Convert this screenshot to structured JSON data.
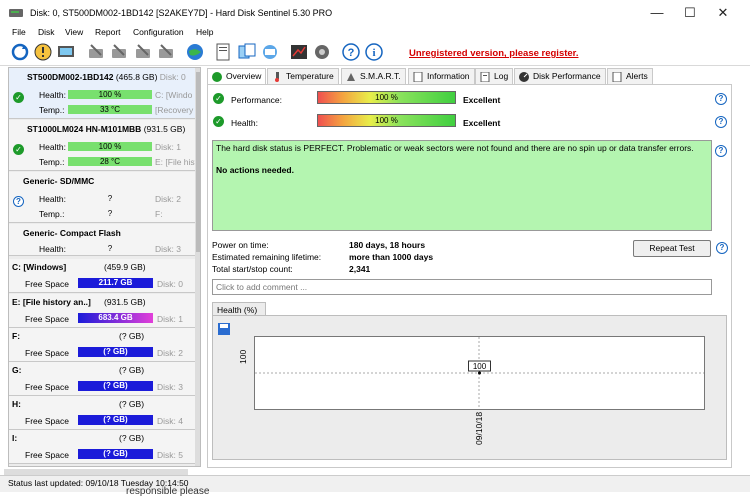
{
  "window": {
    "title": "Disk: 0, ST500DM002-1BD142 [S2AKEY7D]  -  Hard Disk Sentinel 5.30 PRO",
    "minimize": "—",
    "maximize": "☐",
    "close": "✕"
  },
  "menu": [
    "File",
    "Disk",
    "View",
    "Report",
    "Configuration",
    "Help"
  ],
  "toolbar": {
    "unregistered": "Unregistered version, please register."
  },
  "disks": [
    {
      "name": "ST500DM002-1BD142",
      "size": "(465.8 GB)",
      "disk": "Disk: 0",
      "health_label": "Health:",
      "health": "100 %",
      "health_side": "C: [Windo",
      "temp_label": "Temp.:",
      "temp": "33 °C",
      "temp_side": "[Recovery"
    },
    {
      "name": "ST1000LM024 HN-M101MBB",
      "size": "(931.5 GB)",
      "disk": "",
      "health_label": "Health:",
      "health": "100 %",
      "health_side": "Disk: 1",
      "temp_label": "Temp.:",
      "temp": "28 °C",
      "temp_side": "E: [File hist"
    },
    {
      "name": "Generic- SD/MMC",
      "size": "",
      "disk": "",
      "health_label": "Health:",
      "health": "?",
      "health_side": "Disk: 2",
      "temp_label": "Temp.:",
      "temp": "?",
      "temp_side": "F:"
    },
    {
      "name": "Generic- Compact Flash",
      "size": "",
      "disk": "",
      "health_label": "Health:",
      "health": "?",
      "health_side": "Disk: 3"
    }
  ],
  "partitions": [
    {
      "name": "C: [Windows]",
      "size": "(459.9 GB)",
      "fs_label": "Free Space",
      "free": "211.7 GB",
      "disk": "Disk: 0"
    },
    {
      "name": "E: [File history an..]",
      "size": "(931.5 GB)",
      "fs_label": "Free Space",
      "free": "683.4 GB",
      "disk": "Disk: 1"
    },
    {
      "name": "F:",
      "size": "(? GB)",
      "fs_label": "Free Space",
      "free": "(? GB)",
      "disk": "Disk: 2"
    },
    {
      "name": "G:",
      "size": "(? GB)",
      "fs_label": "Free Space",
      "free": "(? GB)",
      "disk": "Disk: 3"
    },
    {
      "name": "H:",
      "size": "(? GB)",
      "fs_label": "Free Space",
      "free": "(? GB)",
      "disk": "Disk: 4"
    },
    {
      "name": "I:",
      "size": "(? GB)",
      "fs_label": "Free Space",
      "free": "(? GB)",
      "disk": "Disk: 5"
    }
  ],
  "tabs": [
    "Overview",
    "Temperature",
    "S.M.A.R.T.",
    "Information",
    "Log",
    "Disk Performance",
    "Alerts"
  ],
  "overview": {
    "performance_label": "Performance:",
    "performance_value": "100 %",
    "performance_rating": "Excellent",
    "health_label": "Health:",
    "health_value": "100 %",
    "health_rating": "Excellent",
    "status_text": "The hard disk status is PERFECT. Problematic or weak sectors were not found and there are no spin up or data transfer errors.",
    "status_action": "No actions needed.",
    "power_on_label": "Power on time:",
    "power_on_value": "180 days, 18 hours",
    "lifetime_label": "Estimated remaining lifetime:",
    "lifetime_value": "more than 1000 days",
    "startstop_label": "Total start/stop count:",
    "startstop_value": "2,341",
    "repeat_button": "Repeat Test",
    "comment_placeholder": "Click to add comment ...",
    "graph_tab": "Health (%)"
  },
  "chart_data": {
    "type": "line",
    "x": [
      "09/10/18"
    ],
    "series": [
      {
        "values": [
          100
        ]
      }
    ],
    "ylabel": "",
    "xlabel": "",
    "point_label": "100",
    "y_tick": "100"
  },
  "statusbar": "Status last updated: 09/10/18 Tuesday 10:14:50",
  "behind_text": "responsible please"
}
